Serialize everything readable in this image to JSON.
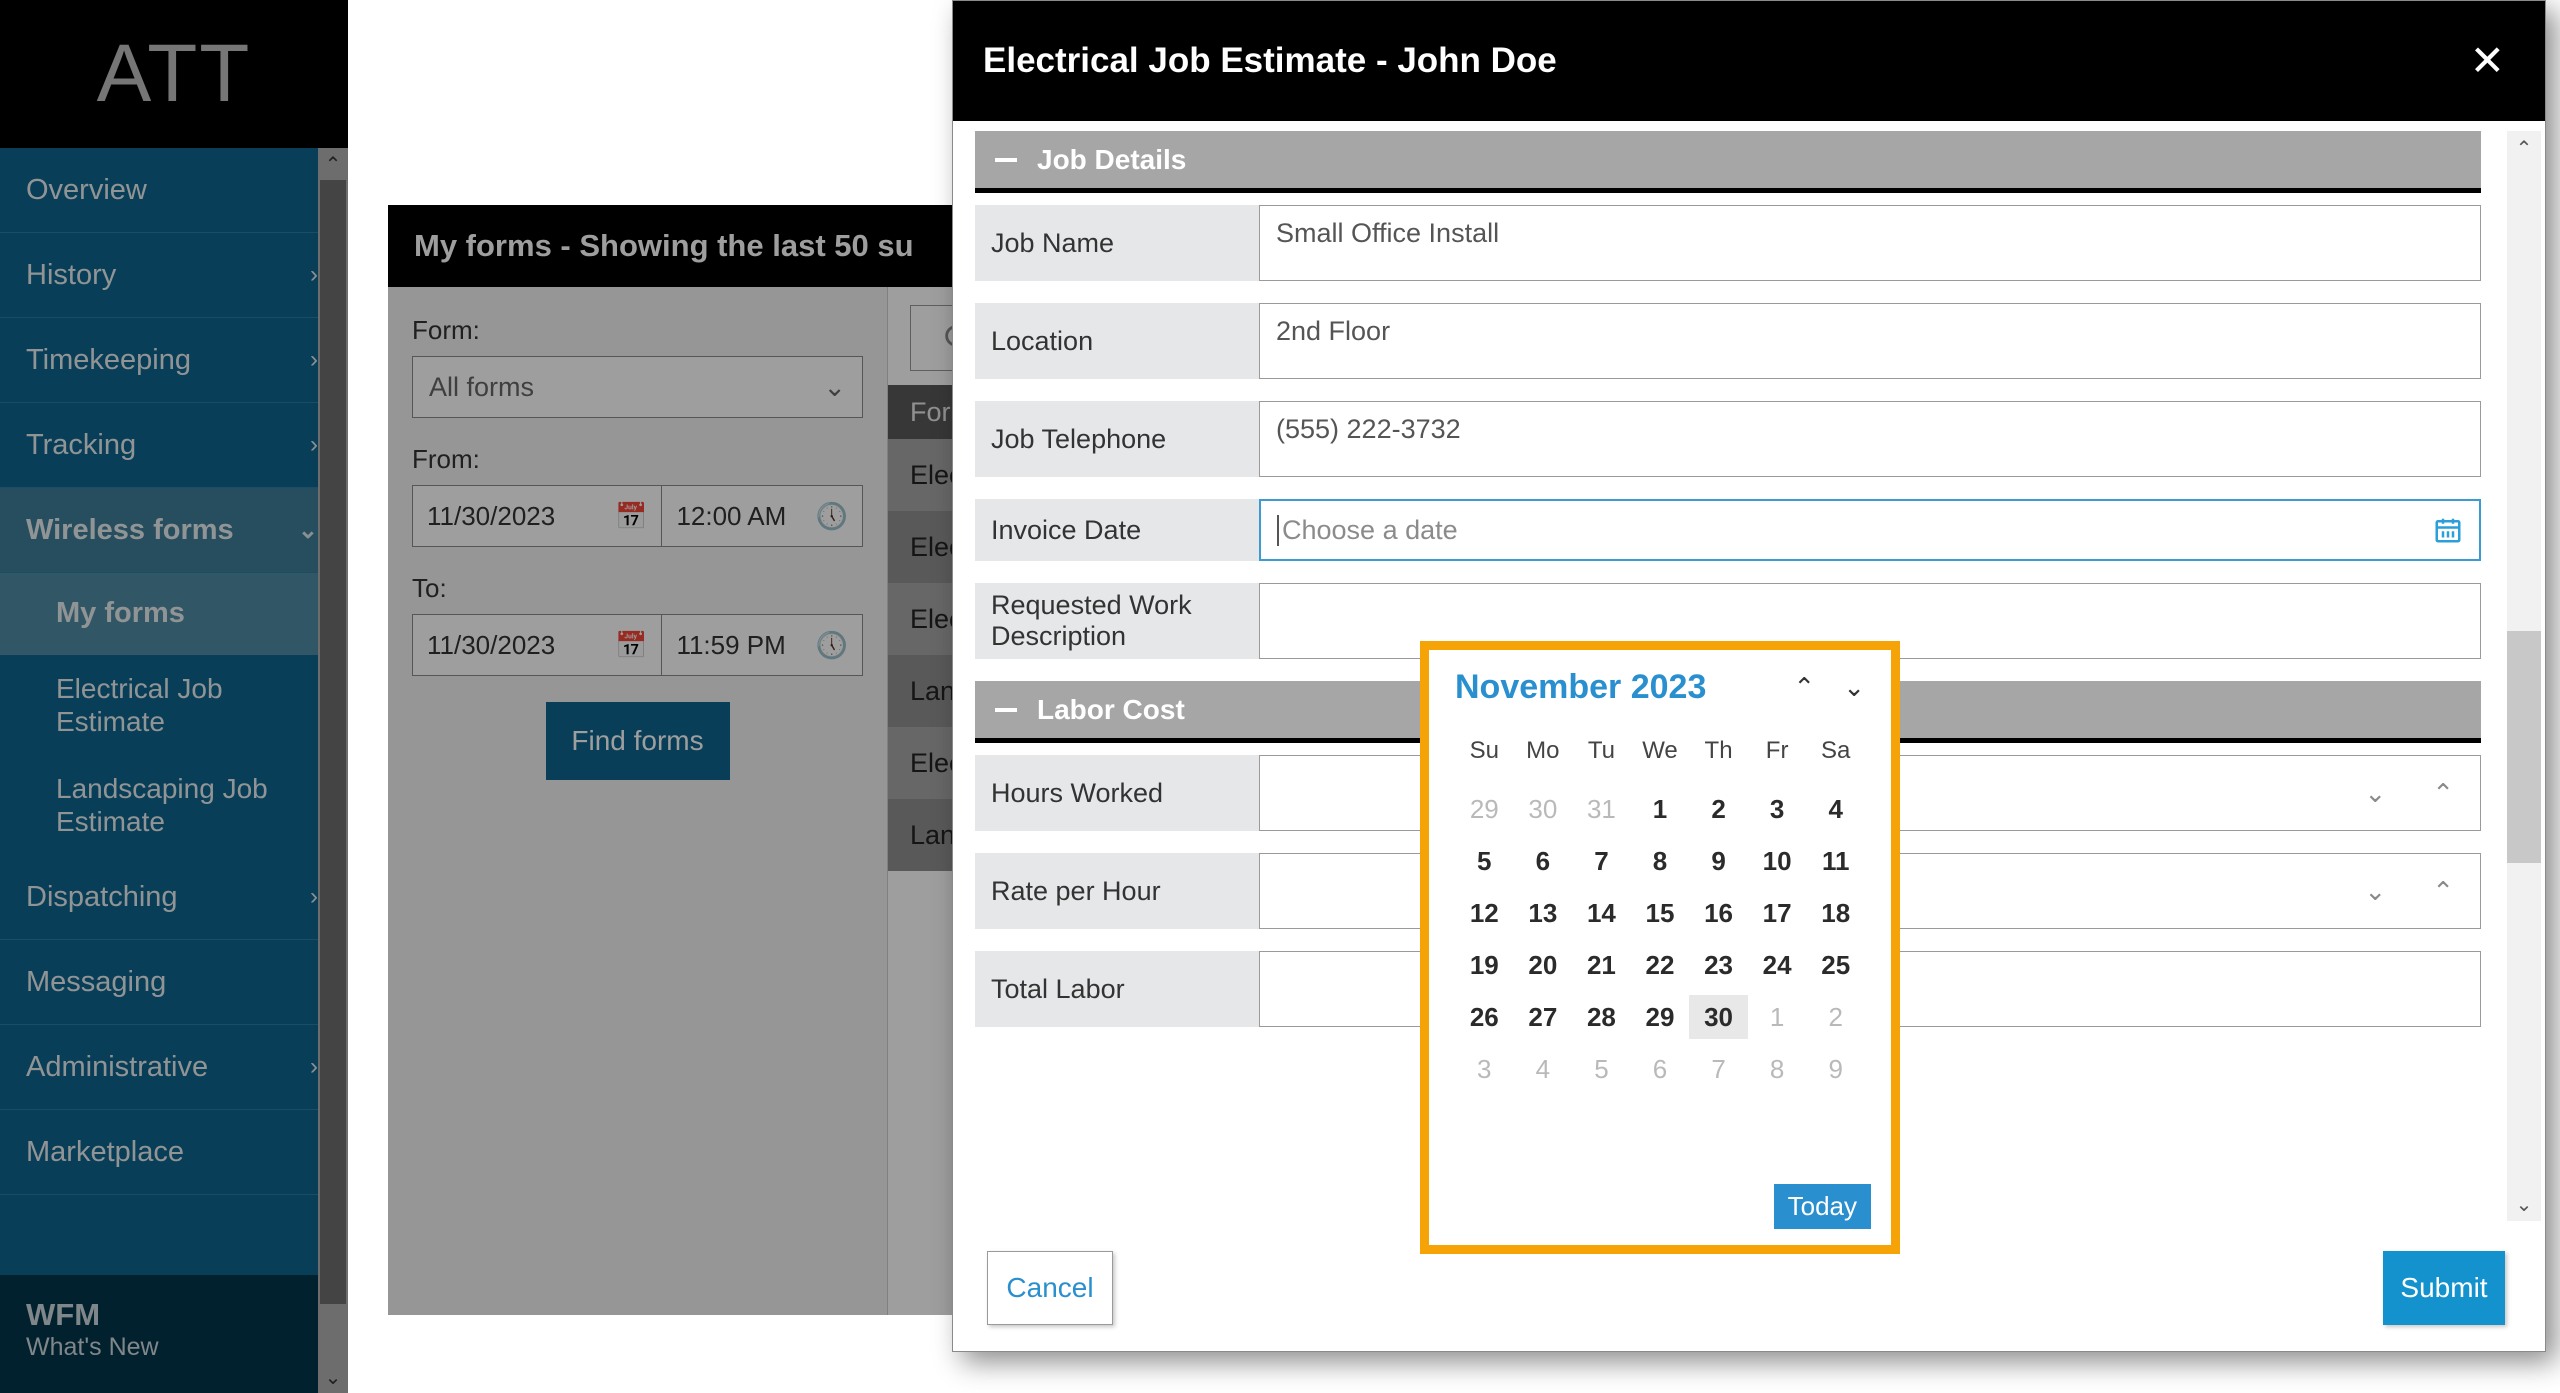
{
  "brand": {
    "logo_text": "ATT"
  },
  "sidebar": {
    "items": [
      {
        "label": "Overview",
        "chevron": ""
      },
      {
        "label": "History",
        "chevron": "›"
      },
      {
        "label": "Timekeeping",
        "chevron": "›"
      },
      {
        "label": "Tracking",
        "chevron": "›"
      },
      {
        "label": "Wireless forms",
        "chevron": "⌄"
      },
      {
        "label": "My forms",
        "chevron": ""
      },
      {
        "label": "Electrical Job Estimate",
        "chevron": ""
      },
      {
        "label": "Landscaping Job Estimate",
        "chevron": ""
      },
      {
        "label": "Dispatching",
        "chevron": "›"
      },
      {
        "label": "Messaging",
        "chevron": ""
      },
      {
        "label": "Administrative",
        "chevron": "›"
      },
      {
        "label": "Marketplace",
        "chevron": ""
      }
    ],
    "footer": {
      "title": "WFM",
      "subtitle": "What's New"
    },
    "scroll_up_icon": "⌃",
    "scroll_down_icon": "⌄"
  },
  "forms_panel": {
    "header": "My forms - Showing the last 50 su",
    "filters": {
      "form_label": "Form:",
      "form_value": "All forms",
      "form_chevron": "⌄",
      "from_label": "From:",
      "from_date": "11/30/2023",
      "from_time": "12:00 AM",
      "to_label": "To:",
      "to_date": "11/30/2023",
      "to_time": "11:59 PM",
      "calendar_icon": "Ὄ5",
      "clock_icon": "◷",
      "find_button": "Find forms"
    },
    "search_icon": "⚲",
    "list_header": "For",
    "rows": [
      "Elec",
      "Elec",
      "Elec",
      "Land",
      "Elec",
      "Land"
    ]
  },
  "modal": {
    "title": "Electrical Job Estimate - John Doe",
    "close_icon": "✕",
    "sections": [
      {
        "title": "Job Details",
        "fields": [
          {
            "label": "Job Name",
            "value": "Small Office Install",
            "type": "text"
          },
          {
            "label": "Location",
            "value": "2nd Floor",
            "type": "text"
          },
          {
            "label": "Job Telephone",
            "value": "(555) 222-3732",
            "type": "text"
          },
          {
            "label": "Invoice Date",
            "value": "",
            "placeholder": "Choose a date",
            "type": "date"
          },
          {
            "label": "Requested Work Description",
            "value": "",
            "type": "text"
          }
        ]
      },
      {
        "title": "Labor Cost",
        "fields": [
          {
            "label": "Hours Worked",
            "value": "",
            "type": "spinner"
          },
          {
            "label": "Rate per Hour",
            "value": "",
            "type": "spinner"
          },
          {
            "label": "Total Labor",
            "value": "",
            "type": "text"
          }
        ]
      }
    ],
    "date_field_calendar_icon": "Ὄ5",
    "spinner_down_icon": "⌄",
    "spinner_up_icon": "⌃",
    "scroll_up_icon": "⌃",
    "scroll_down_icon": "⌄",
    "cancel_label": "Cancel",
    "submit_label": "Submit"
  },
  "datepicker": {
    "month_year": "November 2023",
    "prev_icon": "⌃",
    "next_icon": "⌄",
    "weekdays": [
      "Su",
      "Mo",
      "Tu",
      "We",
      "Th",
      "Fr",
      "Sa"
    ],
    "weeks": [
      [
        {
          "d": "29",
          "muted": true
        },
        {
          "d": "30",
          "muted": true
        },
        {
          "d": "31",
          "muted": true
        },
        {
          "d": "1"
        },
        {
          "d": "2"
        },
        {
          "d": "3"
        },
        {
          "d": "4"
        }
      ],
      [
        {
          "d": "5"
        },
        {
          "d": "6"
        },
        {
          "d": "7"
        },
        {
          "d": "8"
        },
        {
          "d": "9"
        },
        {
          "d": "10"
        },
        {
          "d": "11"
        }
      ],
      [
        {
          "d": "12"
        },
        {
          "d": "13"
        },
        {
          "d": "14"
        },
        {
          "d": "15"
        },
        {
          "d": "16"
        },
        {
          "d": "17"
        },
        {
          "d": "18"
        }
      ],
      [
        {
          "d": "19"
        },
        {
          "d": "20"
        },
        {
          "d": "21"
        },
        {
          "d": "22"
        },
        {
          "d": "23"
        },
        {
          "d": "24"
        },
        {
          "d": "25"
        }
      ],
      [
        {
          "d": "26"
        },
        {
          "d": "27"
        },
        {
          "d": "28"
        },
        {
          "d": "29"
        },
        {
          "d": "30",
          "today": true
        },
        {
          "d": "1",
          "muted": true
        },
        {
          "d": "2",
          "muted": true
        }
      ],
      [
        {
          "d": "3",
          "muted": true
        },
        {
          "d": "4",
          "muted": true
        },
        {
          "d": "5",
          "muted": true
        },
        {
          "d": "6",
          "muted": true
        },
        {
          "d": "7",
          "muted": true
        },
        {
          "d": "8",
          "muted": true
        },
        {
          "d": "9",
          "muted": true
        }
      ]
    ],
    "today_label": "Today",
    "highlight_color": "#f5a306",
    "accent_color": "#2a8fcf"
  }
}
